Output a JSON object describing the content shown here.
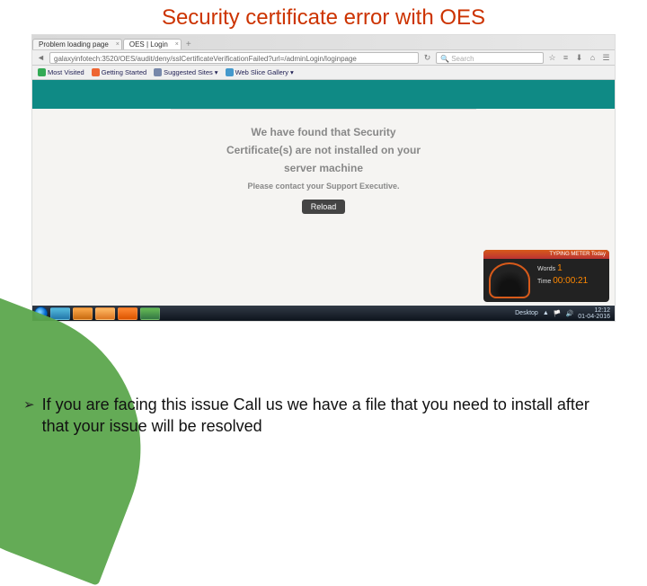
{
  "slide": {
    "title": "Security certificate error with OES",
    "bullet_marker": "➢",
    "bullet_text": "If you are facing this issue Call us we have a file that you need to install after that your issue will be resolved"
  },
  "browser": {
    "tabs": [
      {
        "label": "Problem loading page"
      },
      {
        "label": "OES | Login"
      }
    ],
    "address": "galaxyinfotech:3520/OES/audit/deny/sslCertificateVerificationFailed?url=/adminLogin/loginpage",
    "search_placeholder": "Search",
    "refresh_glyph": "↻",
    "bookmarks": [
      {
        "label": "Most Visited"
      },
      {
        "label": "Getting Started"
      },
      {
        "label": "Suggested Sites"
      },
      {
        "label": "Web Slice Gallery"
      }
    ],
    "toolbar_icons": {
      "star": "☆",
      "list": "≡",
      "download": "⬇",
      "home": "⌂",
      "menu": "☰"
    }
  },
  "page_message": {
    "line1": "We have found that Security",
    "line2": "Certificate(s) are not installed on your",
    "line3": "server machine",
    "sub": "Please contact your Support Executive.",
    "button": "Reload"
  },
  "meter": {
    "title": "TYPING METER Today",
    "words_label": "Words",
    "words_value": "1",
    "time_label": "Time",
    "time_value": "00:00:21",
    "gauge_value": "00"
  },
  "taskbar": {
    "desktop_label": "Desktop",
    "tray_flag": "▲",
    "clock_time": "12:12",
    "clock_date": "01-04-2016"
  }
}
